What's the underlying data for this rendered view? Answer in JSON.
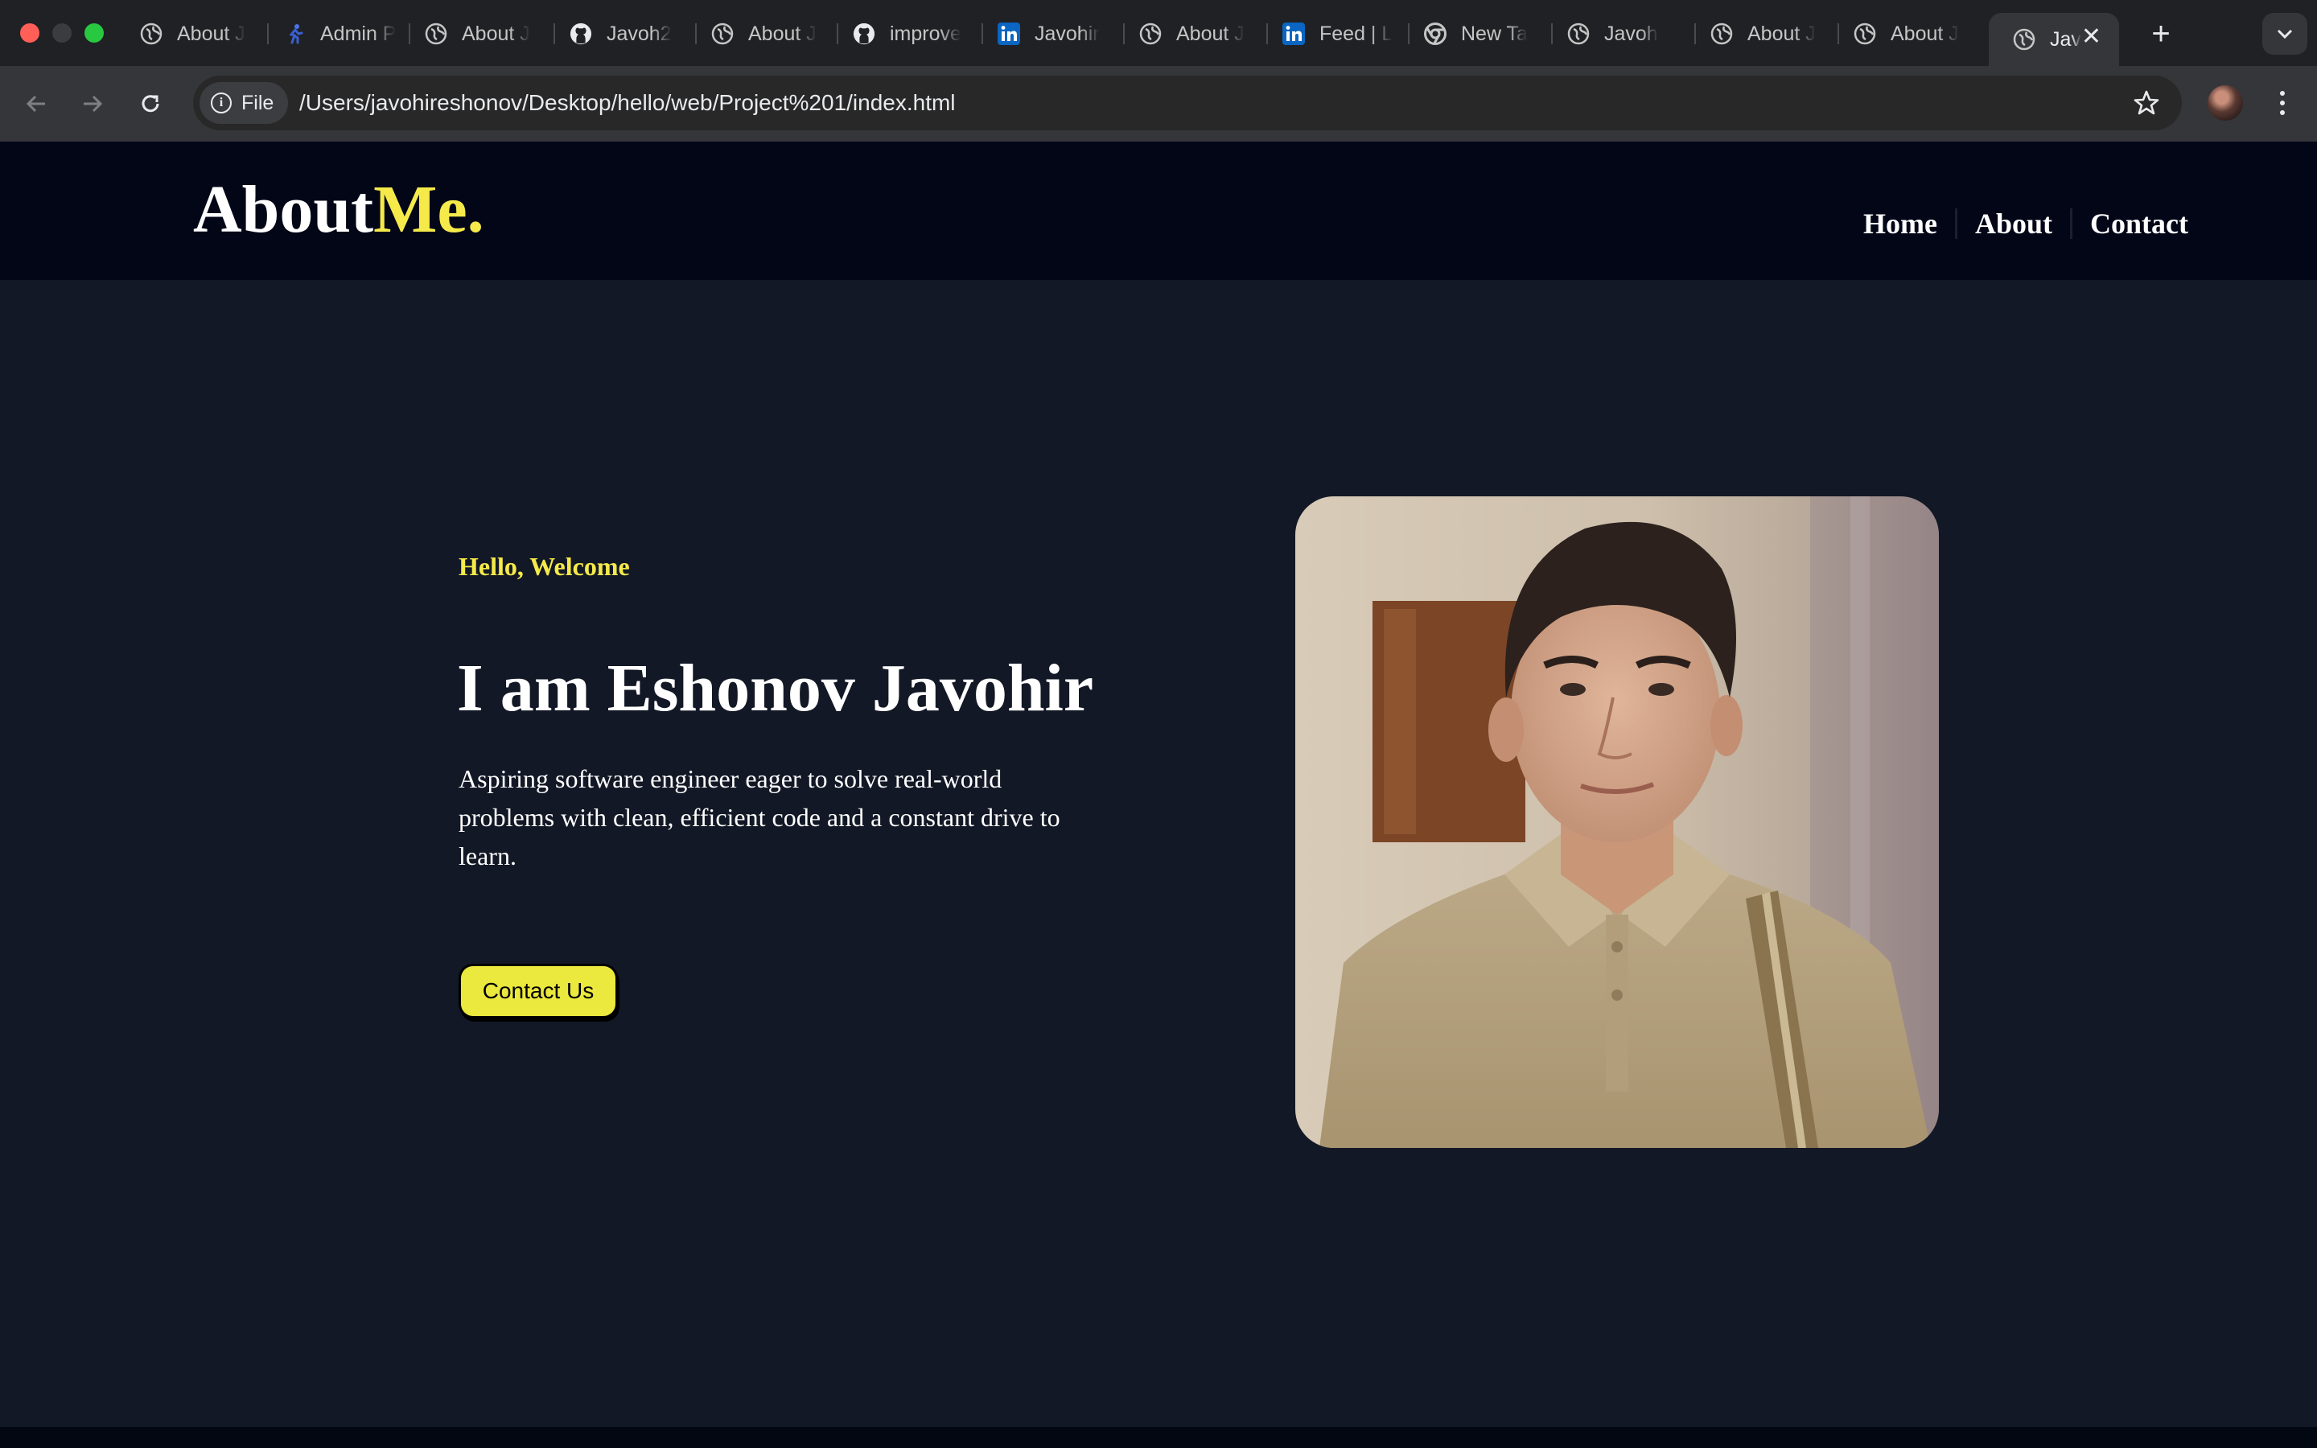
{
  "browser": {
    "tabs": [
      {
        "label": "About J",
        "icon": "globe-icon"
      },
      {
        "label": "Admin P",
        "icon": "figure-icon"
      },
      {
        "label": "About J",
        "icon": "globe-icon"
      },
      {
        "label": "Javoh2",
        "icon": "github-icon"
      },
      {
        "label": "About J",
        "icon": "globe-icon"
      },
      {
        "label": "improve",
        "icon": "github-icon"
      },
      {
        "label": "Javohir",
        "icon": "linkedin-icon"
      },
      {
        "label": "About J",
        "icon": "globe-icon"
      },
      {
        "label": "Feed | L",
        "icon": "linkedin-icon"
      },
      {
        "label": "New Ta",
        "icon": "chrome-icon"
      },
      {
        "label": "Javoh",
        "icon": "globe-icon"
      },
      {
        "label": "About J",
        "icon": "globe-icon"
      },
      {
        "label": "About J",
        "icon": "globe-icon"
      }
    ],
    "active_tab": {
      "label": "Jav",
      "icon": "globe-icon"
    },
    "address": {
      "chip_label": "File",
      "url": "/Users/javohireshonov/Desktop/hello/web/Project%201/index.html"
    }
  },
  "site": {
    "logo": {
      "main": "About",
      "accent": "Me."
    },
    "nav": {
      "home": "Home",
      "about": "About",
      "contact": "Contact"
    },
    "hero": {
      "greeting": "Hello, Welcome",
      "headline": "I am Eshonov Javohir",
      "bio": "Aspiring software engineer eager to solve real-world problems with clean, efficient code and a constant drive to learn.",
      "cta": "Contact Us"
    }
  },
  "colors": {
    "accent": "#f5ea4a",
    "header_bg": "#020617",
    "page_bg": "#131826",
    "button_bg": "#ebe83e"
  }
}
